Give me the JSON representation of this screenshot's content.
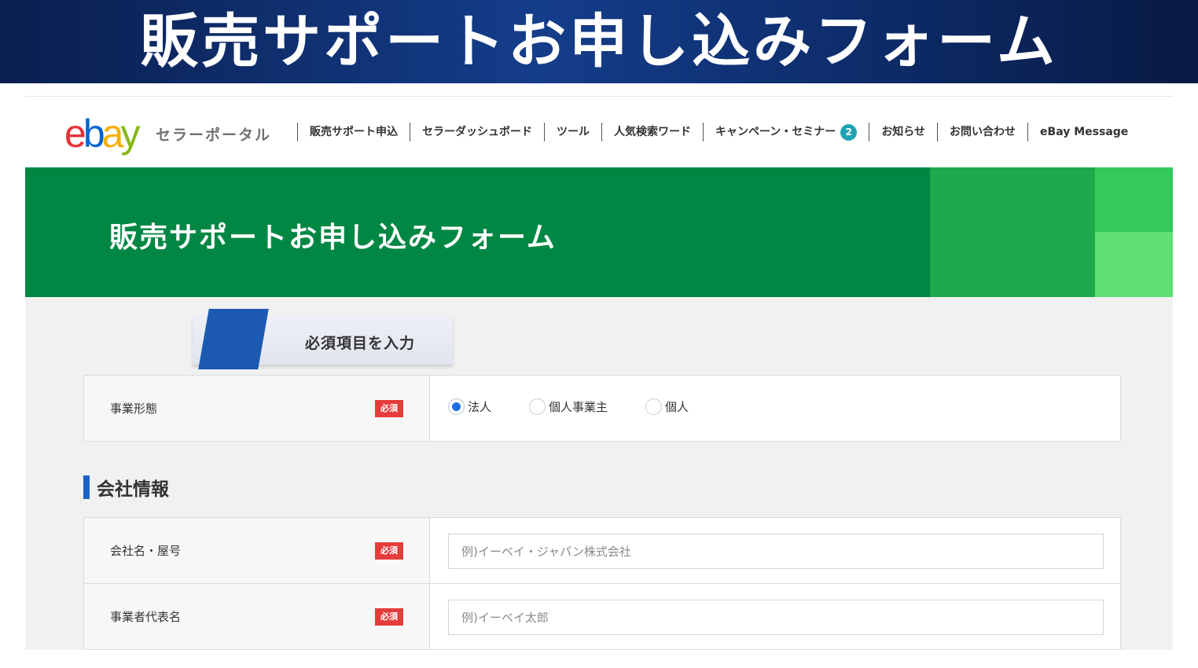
{
  "banner": {
    "title": "販売サポートお申し込みフォーム"
  },
  "header": {
    "logo": {
      "e": "e",
      "b": "b",
      "a": "a",
      "y": "y"
    },
    "portal_label": "セラーポータル",
    "nav": [
      {
        "label": "販売サポート申込"
      },
      {
        "label": "セラーダッシュボード"
      },
      {
        "label": "ツール"
      },
      {
        "label": "人気検索ワード"
      },
      {
        "label": "キャンペーン・セミナー",
        "badge": "2"
      },
      {
        "label": "お知らせ"
      },
      {
        "label": "お問い合わせ"
      },
      {
        "label": "eBay Message"
      }
    ]
  },
  "hero": {
    "title": "販売サポートお申し込みフォーム"
  },
  "required_tab": {
    "label": "必須項目を入力"
  },
  "required_badge": "必須",
  "business_type": {
    "label": "事業形態",
    "options": [
      {
        "label": "法人",
        "checked": true
      },
      {
        "label": "個人事業主",
        "checked": false
      },
      {
        "label": "個人",
        "checked": false
      }
    ]
  },
  "company_section": {
    "title": "会社情報"
  },
  "company_name": {
    "label": "会社名・屋号",
    "value": "",
    "placeholder": "例)イーベイ・ジャパン株式会社"
  },
  "representative": {
    "label": "事業者代表名",
    "value": "",
    "placeholder": "例)イーベイ太郎"
  },
  "colors": {
    "banner_navy": "#0a1f4f",
    "hero_green": "#008744",
    "required_red": "#e63b3b",
    "section_blue": "#1c63c4",
    "badge_teal": "#1fa3b4"
  }
}
